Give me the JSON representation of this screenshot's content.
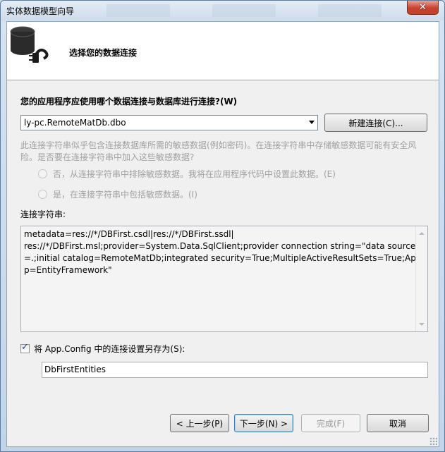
{
  "window": {
    "title": "实体数据模型向导",
    "close_label": "✕"
  },
  "header": {
    "title": "选择您的数据连接",
    "icon": "database-plug-icon"
  },
  "connection": {
    "question": "您的应用程序应使用哪个数据连接与数据库进行连接?(W)",
    "selected": "ly-pc.RemoteMatDb.dbo",
    "new_connection_label": "新建连接(C)..."
  },
  "sensitive": {
    "note": "此连接字符串似乎包含连接数据库所需的敏感数据(例如密码)。在连接字符串中存储敏感数据可能有安全风险。是否要在连接字符串中加入这些敏感数据?",
    "option_no": "否，从连接字符串中排除敏感数据。我将在应用程序代码中设置此数据。(E)",
    "option_yes": "是，在连接字符串中包括敏感数据。(I)"
  },
  "connection_string": {
    "label": "连接字符串:",
    "value": "metadata=res://*/DBFirst.csdl|res://*/DBFirst.ssdl|\nres://*/DBFirst.msl;provider=System.Data.SqlClient;provider connection string=\"data source=.;initial catalog=RemoteMatDb;integrated security=True;MultipleActiveResultSets=True;App=EntityFramework\""
  },
  "save": {
    "checked": true,
    "label": "将 App.Config 中的连接设置另存为(S):",
    "value": "DbFirstEntities"
  },
  "buttons": {
    "prev": "< 上一步(P)",
    "next": "下一步(N) >",
    "finish": "完成(F)",
    "cancel": "取消"
  },
  "colors": {
    "title_bar": "#d7e4f1",
    "close_button": "#c7432f",
    "disabled_text": "#a0a0a0"
  }
}
